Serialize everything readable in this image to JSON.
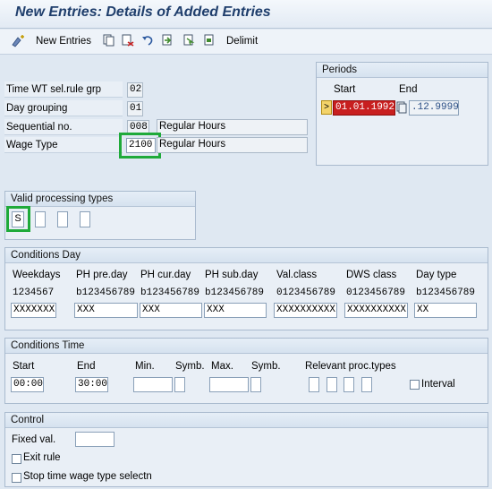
{
  "title": "New Entries: Details of Added Entries",
  "toolbar": {
    "change_label": "New Entries",
    "delimit_label": "Delimit"
  },
  "header": {
    "time_wt_label": "Time WT sel.rule grp",
    "time_wt_value": "02",
    "day_grouping_label": "Day grouping",
    "day_grouping_value": "01",
    "sequential_label": "Sequential no.",
    "sequential_value": "008",
    "sequential_text": "Regular Hours",
    "wage_type_label": "Wage Type",
    "wage_type_value": "2100",
    "wage_type_text": "Regular Hours"
  },
  "periods": {
    "title": "Periods",
    "start_label": "Start",
    "end_label": "End",
    "start_marker": ">",
    "start_value": "01.01.1992",
    "end_value": ".12.9999"
  },
  "valid_processing": {
    "title": "Valid processing types",
    "values": [
      "S",
      "",
      "",
      ""
    ]
  },
  "conditions_day": {
    "title": "Conditions Day",
    "columns": [
      {
        "label": "Weekdays",
        "digits": "1234567",
        "value": "XXXXXXX"
      },
      {
        "label": "PH pre.day",
        "digits": "b123456789",
        "value": "XXX"
      },
      {
        "label": "PH cur.day",
        "digits": "b123456789",
        "value": "XXX"
      },
      {
        "label": "PH sub.day",
        "digits": "b123456789",
        "value": "XXX"
      },
      {
        "label": "Val.class",
        "digits": "0123456789",
        "value": "XXXXXXXXXX"
      },
      {
        "label": "DWS class",
        "digits": "0123456789",
        "value": "XXXXXXXXXX"
      },
      {
        "label": "Day type",
        "digits": "b123456789",
        "value": "XX"
      }
    ]
  },
  "conditions_time": {
    "title": "Conditions Time",
    "start_label": "Start",
    "end_label": "End",
    "min_label": "Min.",
    "symb_label": "Symb.",
    "max_label": "Max.",
    "symb2_label": "Symb.",
    "proc_label": "Relevant proc.types",
    "start_value": "00:00",
    "end_value": "30:00",
    "interval_label": "Interval"
  },
  "control": {
    "title": "Control",
    "fixed_val_label": "Fixed val.",
    "exit_rule_label": "Exit rule",
    "stop_label": "Stop time wage type selectn"
  }
}
